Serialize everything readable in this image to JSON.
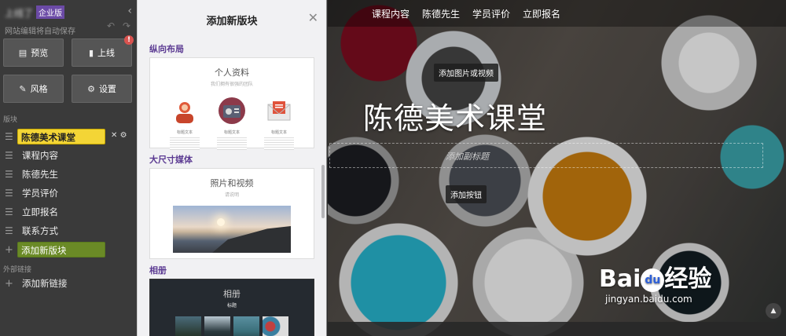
{
  "editor": {
    "site_name": "上线了",
    "badge": "企业版",
    "autosave": "网站编辑将自动保存",
    "buttons": {
      "preview": "预览",
      "publish": "上线",
      "publish_alert": "!",
      "style": "风格",
      "settings": "设置"
    },
    "blocks_label": "版块",
    "blocks": [
      {
        "label": "陈德美术课堂"
      },
      {
        "label": "课程内容"
      },
      {
        "label": "陈德先生"
      },
      {
        "label": "学员评价"
      },
      {
        "label": "立即报名"
      },
      {
        "label": "联系方式"
      }
    ],
    "add_block": "添加新版块",
    "external_label": "外部链接",
    "add_link": "添加新链接"
  },
  "add_panel": {
    "title": "添加新版块",
    "categories": [
      {
        "name": "纵向布局",
        "card_title": "个人资料",
        "card_subtitle": "我们拥有很强的团队",
        "captions": [
          "标题文本",
          "标题文本",
          "标题文本"
        ]
      },
      {
        "name": "大尺寸媒体",
        "card_title": "照片和视频",
        "card_subtitle": "请说明"
      },
      {
        "name": "相册",
        "card_title": "相册",
        "card_subtitle": "标题"
      }
    ]
  },
  "preview": {
    "nav": [
      "课程内容",
      "陈德先生",
      "学员评价",
      "立即报名"
    ],
    "add_media": "添加图片或视频",
    "hero_title": "陈德美术课堂",
    "subtitle_placeholder": "添加副标题",
    "add_button": "添加按钮",
    "watermark_brand": "Bai",
    "watermark_brand_tail": "经验",
    "watermark_url": "jingyan.baidu.com"
  },
  "colors": {
    "active_block": "#f3d536",
    "add_block": "#6a8a26",
    "badge": "#6b4aa6",
    "category": "#5b3a92"
  }
}
